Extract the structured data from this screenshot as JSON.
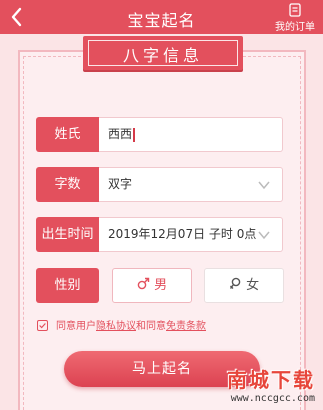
{
  "header": {
    "title": "宝宝起名",
    "orders_label": "我的订单",
    "back_icon": "back-chevron-icon",
    "orders_icon": "document-icon"
  },
  "section": {
    "title": "八字信息"
  },
  "form": {
    "surname": {
      "label": "姓氏",
      "value": "西西"
    },
    "name_length": {
      "label": "字数",
      "value": "双字"
    },
    "birth_time": {
      "label": "出生时间",
      "value": "2019年12月07日 子时 0点"
    },
    "gender": {
      "label": "性别",
      "male": "男",
      "female": "女",
      "selected": "male"
    }
  },
  "agreement": {
    "text_prefix": "同意用户",
    "privacy_link": "隐私协议",
    "middle": "和同意",
    "terms_link": "免责条款",
    "checked": true
  },
  "submit_label": "马上起名",
  "watermark": {
    "title": "南城下载",
    "url": "www.nccgcc.com"
  },
  "colors": {
    "accent": "#e3505d",
    "background": "#fbe4e6"
  }
}
